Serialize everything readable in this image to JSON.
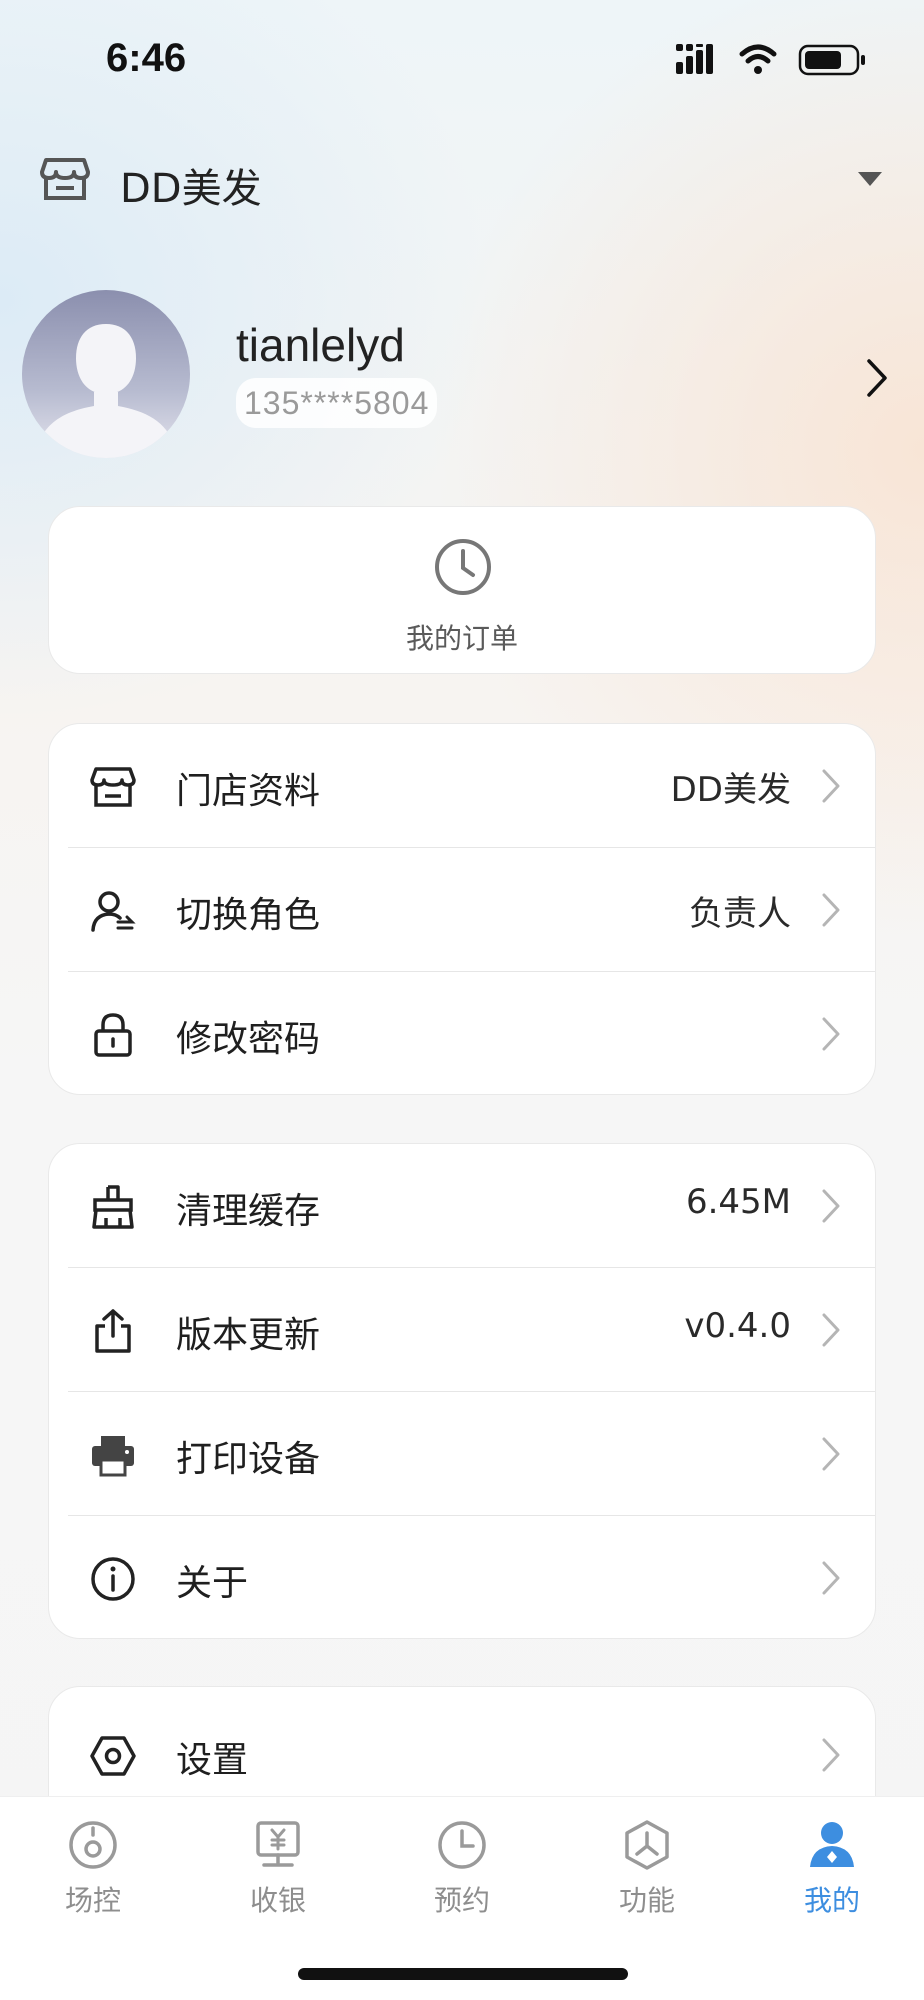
{
  "status": {
    "time": "6:46"
  },
  "store": {
    "name": "DD美发",
    "icon": "store-icon"
  },
  "profile": {
    "username": "tianlelyd",
    "phone": "135****5804"
  },
  "orders": {
    "label": "我的订单",
    "icon": "clock-icon"
  },
  "group1": [
    {
      "label": "门店资料",
      "value": "DD美发",
      "icon": "store-icon"
    },
    {
      "label": "切换角色",
      "value": "负责人",
      "icon": "switch-user-icon"
    },
    {
      "label": "修改密码",
      "value": "",
      "icon": "lock-icon"
    }
  ],
  "group2": [
    {
      "label": "清理缓存",
      "value": "6.45M",
      "icon": "broom-icon"
    },
    {
      "label": "版本更新",
      "value": "v0.4.0",
      "icon": "upload-icon"
    },
    {
      "label": "打印设备",
      "value": "",
      "icon": "printer-icon"
    },
    {
      "label": "关于",
      "value": "",
      "icon": "info-icon"
    }
  ],
  "group3": [
    {
      "label": "设置",
      "value": "",
      "icon": "hexagon-settings-icon"
    }
  ],
  "tabs": [
    {
      "label": "场控",
      "icon": "target-icon",
      "active": false
    },
    {
      "label": "收银",
      "icon": "cashier-icon",
      "active": false
    },
    {
      "label": "预约",
      "icon": "clock-icon",
      "active": false
    },
    {
      "label": "功能",
      "icon": "function-icon",
      "active": false
    },
    {
      "label": "我的",
      "icon": "user-icon",
      "active": true
    }
  ],
  "colors": {
    "accent": "#3d8ee0",
    "text": "#1f1f1f",
    "muted": "#8e8e8e"
  }
}
